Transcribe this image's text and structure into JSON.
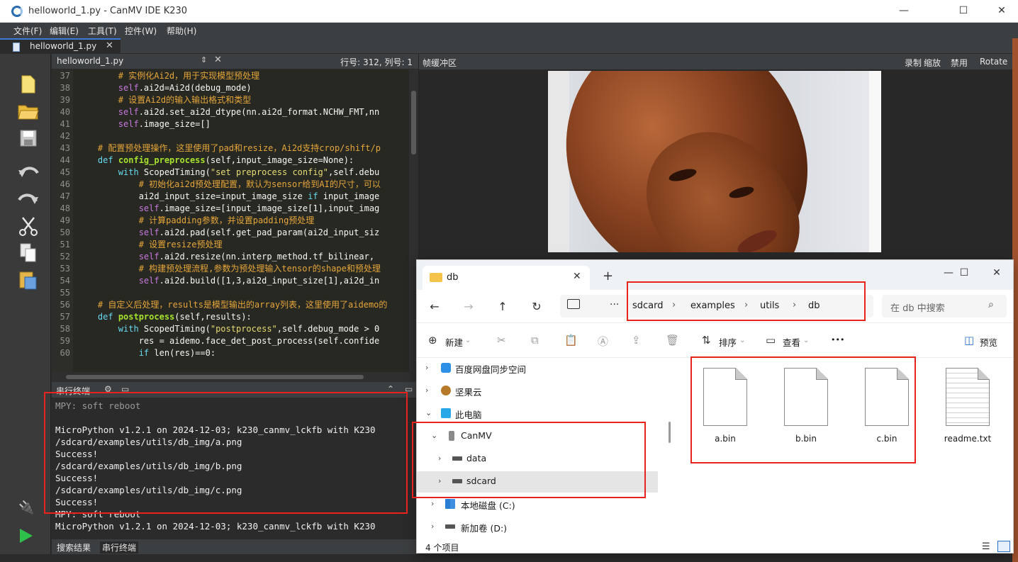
{
  "ide": {
    "title": "helloworld_1.py - CanMV IDE K230",
    "window_controls": [
      "—",
      "☐",
      "✕"
    ],
    "menu": [
      "文件(F)",
      "编辑(E)",
      "工具(T)",
      "控件(W)",
      "帮助(H)"
    ],
    "open_tab": "helloworld_1.py",
    "editor_file": "helloworld_1.py",
    "cursor_position": "行号: 312, 列号: 1",
    "frame_buffer": {
      "title": "帧缓冲区",
      "actions": [
        "录制",
        "缩放",
        "禁用",
        "Rotate"
      ]
    },
    "code_lines": [
      {
        "n": "37",
        "parts": [
          {
            "t": "        ",
            "c": "txt"
          },
          {
            "t": "# 实例化Ai2d，用于实现模型预处理",
            "c": "com"
          }
        ]
      },
      {
        "n": "38",
        "parts": [
          {
            "t": "        ",
            "c": "txt"
          },
          {
            "t": "self",
            "c": "self"
          },
          {
            "t": ".ai2d=Ai2d(debug_mode)",
            "c": "txt"
          }
        ]
      },
      {
        "n": "39",
        "parts": [
          {
            "t": "        ",
            "c": "txt"
          },
          {
            "t": "# 设置Ai2d的输入输出格式和类型",
            "c": "com"
          }
        ]
      },
      {
        "n": "40",
        "parts": [
          {
            "t": "        ",
            "c": "txt"
          },
          {
            "t": "self",
            "c": "self"
          },
          {
            "t": ".ai2d.set_ai2d_dtype(nn.ai2d_format.NCHW_FMT,nn",
            "c": "txt"
          }
        ]
      },
      {
        "n": "41",
        "parts": [
          {
            "t": "        ",
            "c": "txt"
          },
          {
            "t": "self",
            "c": "self"
          },
          {
            "t": ".image_size=[]",
            "c": "txt"
          }
        ]
      },
      {
        "n": "42",
        "parts": []
      },
      {
        "n": "43",
        "parts": [
          {
            "t": "    ",
            "c": "txt"
          },
          {
            "t": "# 配置预处理操作，这里使用了pad和resize，Ai2d支持crop/shift/p",
            "c": "com"
          }
        ]
      },
      {
        "n": "44",
        "parts": [
          {
            "t": "    ",
            "c": "txt"
          },
          {
            "t": "def ",
            "c": "kw"
          },
          {
            "t": "config_preprocess",
            "c": "fn"
          },
          {
            "t": "(self,input_image_size=None):",
            "c": "txt"
          }
        ]
      },
      {
        "n": "45",
        "parts": [
          {
            "t": "        ",
            "c": "txt"
          },
          {
            "t": "with ",
            "c": "kw"
          },
          {
            "t": "ScopedTiming(",
            "c": "txt"
          },
          {
            "t": "\"set preprocess config\"",
            "c": "str"
          },
          {
            "t": ",self.debu",
            "c": "txt"
          }
        ]
      },
      {
        "n": "46",
        "parts": [
          {
            "t": "            ",
            "c": "txt"
          },
          {
            "t": "# 初始化ai2d预处理配置，默认为sensor给到AI的尺寸，可以",
            "c": "com"
          }
        ]
      },
      {
        "n": "47",
        "parts": [
          {
            "t": "            ai2d_input_size=input_image_size ",
            "c": "txt"
          },
          {
            "t": "if ",
            "c": "kw"
          },
          {
            "t": "input_image",
            "c": "txt"
          }
        ]
      },
      {
        "n": "48",
        "parts": [
          {
            "t": "            ",
            "c": "txt"
          },
          {
            "t": "self",
            "c": "self"
          },
          {
            "t": ".image_size=[input_image_size[1],input_imag",
            "c": "txt"
          }
        ]
      },
      {
        "n": "49",
        "parts": [
          {
            "t": "            ",
            "c": "txt"
          },
          {
            "t": "# 计算padding参数，并设置padding预处理",
            "c": "com"
          }
        ]
      },
      {
        "n": "50",
        "parts": [
          {
            "t": "            ",
            "c": "txt"
          },
          {
            "t": "self",
            "c": "self"
          },
          {
            "t": ".ai2d.pad(self.get_pad_param(ai2d_input_siz",
            "c": "txt"
          }
        ]
      },
      {
        "n": "51",
        "parts": [
          {
            "t": "            ",
            "c": "txt"
          },
          {
            "t": "# 设置resize预处理",
            "c": "com"
          }
        ]
      },
      {
        "n": "52",
        "parts": [
          {
            "t": "            ",
            "c": "txt"
          },
          {
            "t": "self",
            "c": "self"
          },
          {
            "t": ".ai2d.resize(nn.interp_method.tf_bilinear,",
            "c": "txt"
          }
        ]
      },
      {
        "n": "53",
        "parts": [
          {
            "t": "            ",
            "c": "txt"
          },
          {
            "t": "# 构建预处理流程,参数为预处理输入tensor的shape和预处理",
            "c": "com"
          }
        ]
      },
      {
        "n": "54",
        "parts": [
          {
            "t": "            ",
            "c": "txt"
          },
          {
            "t": "self",
            "c": "self"
          },
          {
            "t": ".ai2d.build([1,3,ai2d_input_size[1],ai2d_in",
            "c": "txt"
          }
        ]
      },
      {
        "n": "55",
        "parts": []
      },
      {
        "n": "56",
        "parts": [
          {
            "t": "    ",
            "c": "txt"
          },
          {
            "t": "# 自定义后处理，results是模型输出的array列表，这里使用了aidemo的",
            "c": "com"
          }
        ]
      },
      {
        "n": "57",
        "parts": [
          {
            "t": "    ",
            "c": "txt"
          },
          {
            "t": "def ",
            "c": "kw"
          },
          {
            "t": "postprocess",
            "c": "fn"
          },
          {
            "t": "(self,results):",
            "c": "txt"
          }
        ]
      },
      {
        "n": "58",
        "parts": [
          {
            "t": "        ",
            "c": "txt"
          },
          {
            "t": "with ",
            "c": "kw"
          },
          {
            "t": "ScopedTiming(",
            "c": "txt"
          },
          {
            "t": "\"postprocess\"",
            "c": "str"
          },
          {
            "t": ",self.debug_mode > 0",
            "c": "txt"
          }
        ]
      },
      {
        "n": "59",
        "parts": [
          {
            "t": "            res = aidemo.face_det_post_process(self.confide",
            "c": "txt"
          }
        ]
      },
      {
        "n": "60",
        "parts": [
          {
            "t": "            ",
            "c": "txt"
          },
          {
            "t": "if ",
            "c": "kw"
          },
          {
            "t": "len(res)==0:",
            "c": "txt"
          }
        ]
      }
    ],
    "terminal": {
      "title": "串行终端",
      "lines": [
        {
          "t": "MPY: soft reboot",
          "dim": true
        },
        {
          "t": "",
          "dim": false
        },
        {
          "t": "MicroPython v1.2.1 on 2024-12-03; k230_canmv_lckfb with K230",
          "dim": false
        },
        {
          "t": "/sdcard/examples/utils/db_img/a.png",
          "dim": false
        },
        {
          "t": "Success!",
          "dim": false
        },
        {
          "t": "/sdcard/examples/utils/db_img/b.png",
          "dim": false
        },
        {
          "t": "Success!",
          "dim": false
        },
        {
          "t": "/sdcard/examples/utils/db_img/c.png",
          "dim": false
        },
        {
          "t": "Success!",
          "dim": false
        },
        {
          "t": "MPY: soft reboot",
          "dim": false
        },
        {
          "t": "MicroPython v1.2.1 on 2024-12-03; k230_canmv_lckfb with K230",
          "dim": false
        }
      ]
    },
    "bottom_tabs": [
      "搜索结果",
      "串行终端"
    ]
  },
  "explorer": {
    "tab_title": "db",
    "breadcrumbs": [
      "sdcard",
      "examples",
      "utils",
      "db"
    ],
    "search_placeholder": "在 db 中搜索",
    "commands": {
      "new": "新建",
      "sort": "排序",
      "view": "查看",
      "more": "•••",
      "preview": "预览"
    },
    "tree": [
      {
        "label": "百度网盘同步空间",
        "icon": "cloud-icon"
      },
      {
        "label": "坚果云",
        "icon": "nut-icon"
      },
      {
        "label": "此电脑",
        "icon": "pc-icon"
      },
      {
        "label": "CanMV",
        "icon": "phone-icon"
      },
      {
        "label": "data",
        "icon": "drive-icon"
      },
      {
        "label": "sdcard",
        "icon": "drive-icon"
      },
      {
        "label": "本地磁盘 (C:)",
        "icon": "windows-drive-icon"
      },
      {
        "label": "新加卷 (D:)",
        "icon": "drive-icon"
      }
    ],
    "files": [
      "a.bin",
      "b.bin",
      "c.bin",
      "readme.txt"
    ],
    "status": "4 个项目"
  }
}
